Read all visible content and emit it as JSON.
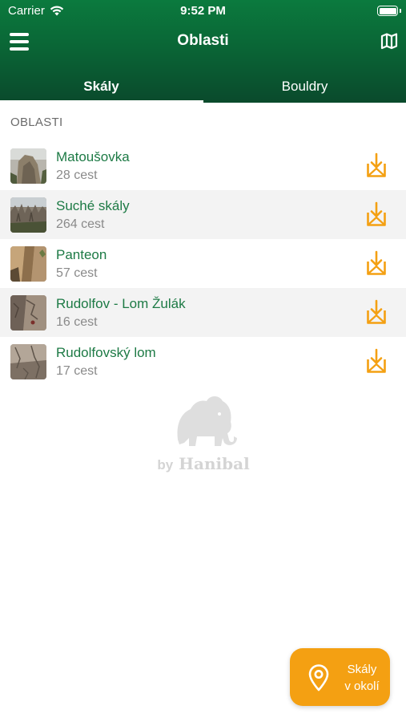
{
  "status_bar": {
    "carrier": "Carrier",
    "time": "9:52 PM"
  },
  "nav": {
    "title": "Oblasti"
  },
  "tabs": [
    {
      "label": "Skály",
      "selected": true
    },
    {
      "label": "Bouldry",
      "selected": false
    }
  ],
  "section": {
    "header": "OBLASTI"
  },
  "areas": [
    {
      "name": "Matoušovka",
      "count": "28 cest"
    },
    {
      "name": "Suché skály",
      "count": "264 cest"
    },
    {
      "name": "Panteon",
      "count": "57 cest"
    },
    {
      "name": "Rudolfov - Lom Žulák",
      "count": "16 cest"
    },
    {
      "name": "Rudolfovský lom",
      "count": "17 cest"
    }
  ],
  "logo": {
    "by": "by",
    "brand": "Hanibal"
  },
  "fab": {
    "line1": "Skály",
    "line2": "v okolí"
  },
  "colors": {
    "header_green": "#0a6636",
    "name_green": "#1d7a45",
    "accent_orange": "#f4a012"
  },
  "icons": {
    "menu": "menu-icon",
    "map": "map-icon",
    "download": "download-icon",
    "location": "location-pin-icon",
    "wifi": "wifi-icon",
    "battery": "battery-icon"
  }
}
